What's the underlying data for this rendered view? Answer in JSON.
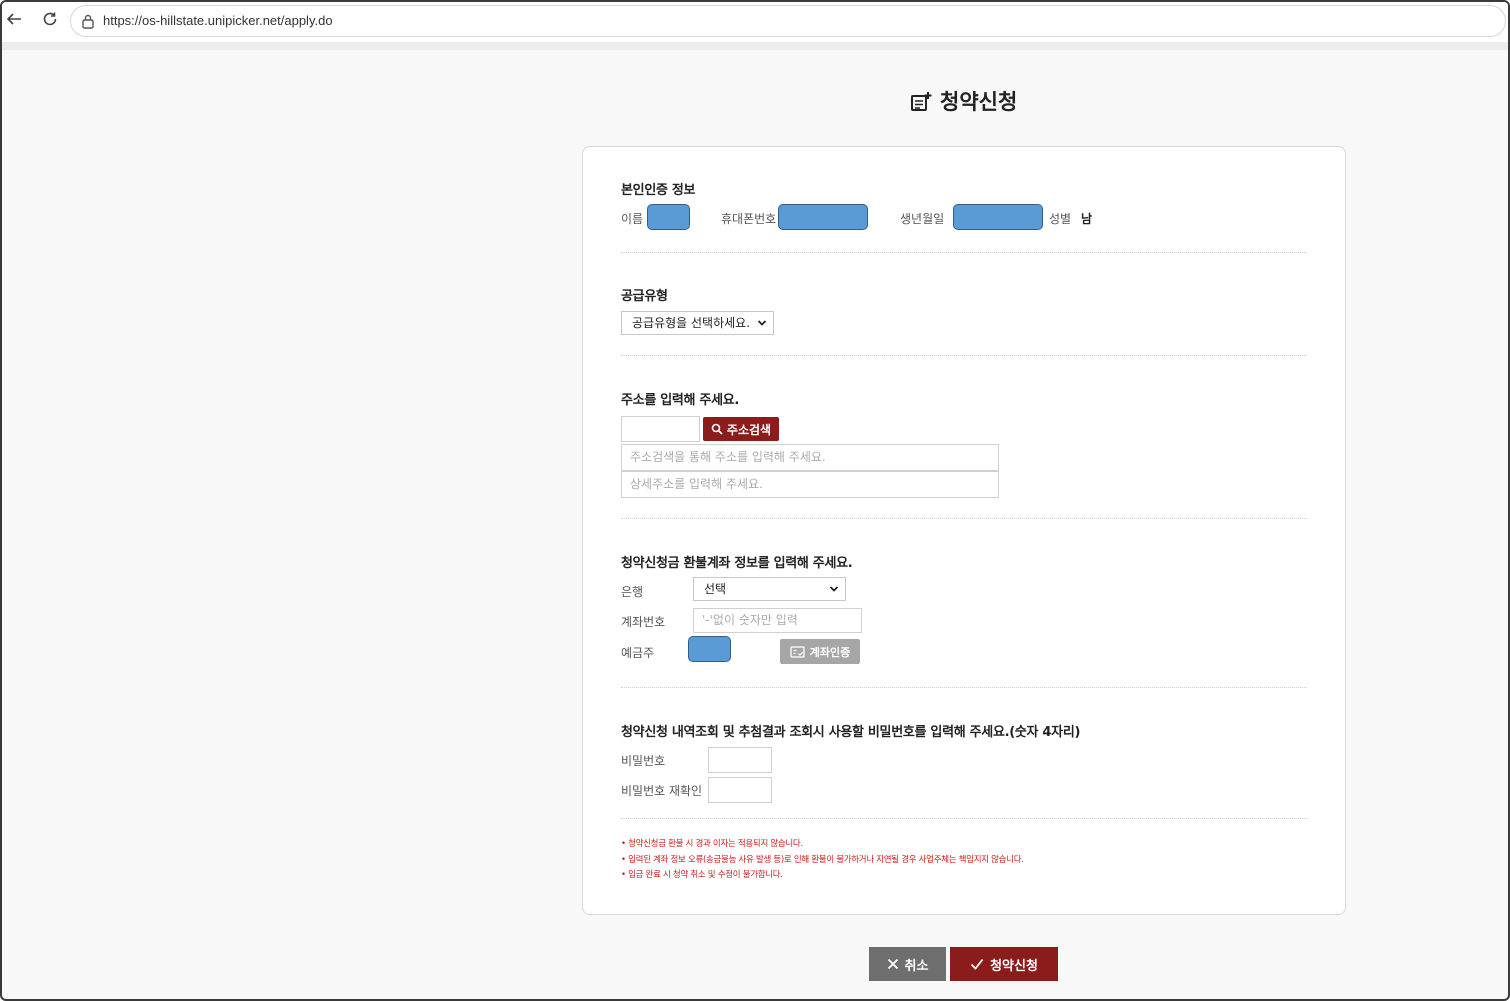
{
  "browser": {
    "url": "https://os-hillstate.unipicker.net/apply.do"
  },
  "page": {
    "title": "청약신청"
  },
  "identity": {
    "section_title": "본인인증 정보",
    "name_label": "이름",
    "phone_label": "휴대폰번호",
    "birth_label": "생년월일",
    "gender_label": "성별",
    "gender_value": "남"
  },
  "supply": {
    "section_title": "공급유형",
    "select_value": "공급유형을 선택하세요."
  },
  "address": {
    "section_title": "주소를 입력해 주세요.",
    "search_button": "주소검색",
    "address_placeholder": "주소검색을 통해 주소를 입력해 주세요.",
    "detail_placeholder": "상세주소를 입력해 주세요."
  },
  "refund": {
    "section_title": "청약신청금 환불계좌 정보를 입력해 주세요.",
    "bank_label": "은행",
    "bank_select_value": "선택",
    "account_label": "계좌번호",
    "account_placeholder": "'-'없이 숫자만 입력",
    "holder_label": "예금주",
    "verify_button": "계좌인증"
  },
  "password": {
    "section_title": "청약신청 내역조회 및 추첨결과 조회시 사용할 비밀번호를 입력해 주세요.(숫자 4자리)",
    "password_label": "비밀번호",
    "confirm_label": "비밀번호 재확인"
  },
  "notes": [
    "• 청약신청금 환불 시 경과 이자는 적용되지 않습니다.",
    "• 입력된 계좌 정보 오류(송금불능 사유 발생 등)로 인해 환불이 불가하거나 지연될 경우 사업주체는 책임지지 않습니다.",
    "• 입금 완료 시 청약 취소 및 수정이 불가합니다."
  ],
  "actions": {
    "cancel_label": "취소",
    "apply_label": "청약신청"
  },
  "colors": {
    "accent": "#8b1c1c",
    "masked": "#5b9bd5",
    "note_red": "#cc1b1b",
    "cancel_gray": "#6e6e6e"
  }
}
